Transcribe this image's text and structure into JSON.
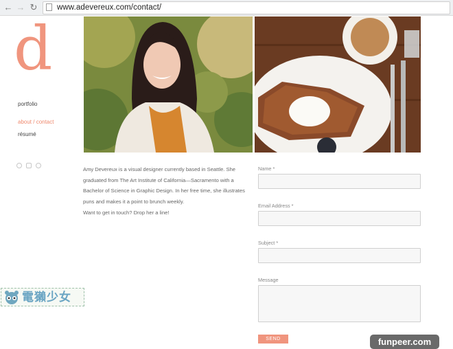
{
  "browser": {
    "url": "www.adevereux.com/contact/",
    "back_icon": "back-arrow-icon",
    "forward_icon": "forward-arrow-icon",
    "reload_icon": "reload-icon"
  },
  "site": {
    "logo_letter": "d",
    "accent_color": "#f0957e",
    "nav": {
      "portfolio": "portfolio",
      "about_contact": "about / contact",
      "resume": "résumé"
    },
    "social_icons": [
      "twitter-icon",
      "instagram-icon",
      "dribbble-icon"
    ]
  },
  "bio": {
    "text": "Amy Devereux is a visual designer currently based in Seattle. She graduated from The Art Institute of California—Sacramento with a Bachelor of Science in Graphic Design. In her free time, she illustrates puns and makes it a point to brunch weekly.",
    "cta": "Want to get in touch? Drop her a line!"
  },
  "form": {
    "name_label": "Name *",
    "email_label": "Email Address *",
    "subject_label": "Subject *",
    "message_label": "Message",
    "send_label": "SEND"
  },
  "watermarks": {
    "left": "電獺少女",
    "right": "funpeer.com"
  }
}
